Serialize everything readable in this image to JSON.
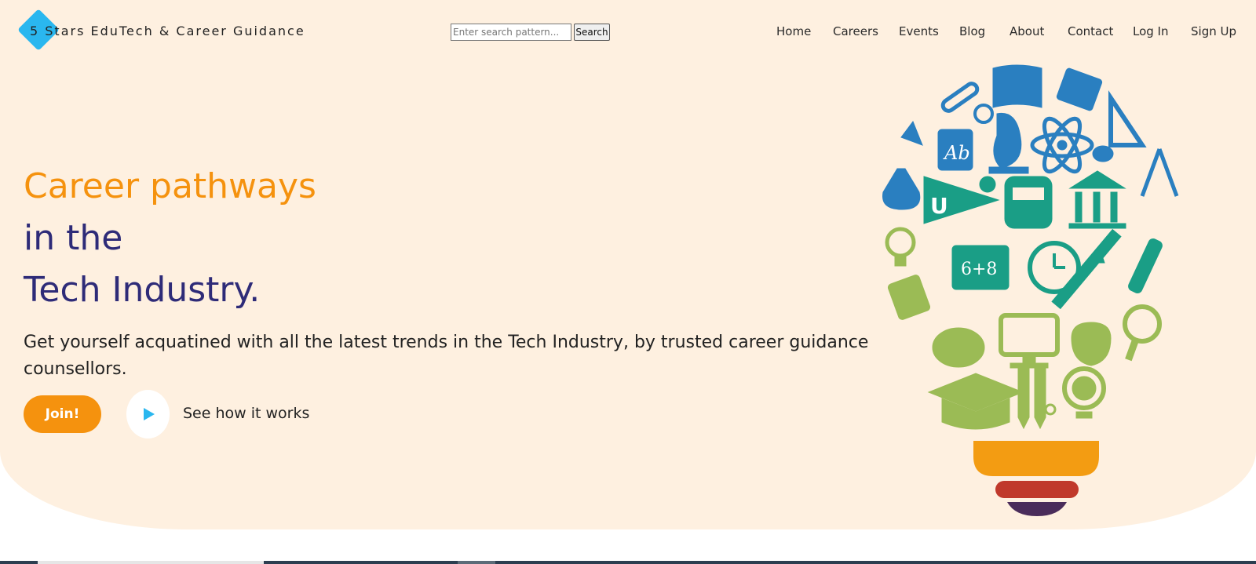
{
  "brand": {
    "name": "5 Stars EduTech & Career Guidance"
  },
  "search": {
    "placeholder": "Enter search pattern...",
    "button_label": "Search"
  },
  "nav": {
    "items": [
      "Home",
      "Careers",
      "Events",
      "Blog",
      "About",
      "Contact",
      "Log In",
      "Sign Up"
    ]
  },
  "hero": {
    "headline_line1": "Career pathways",
    "headline_line2": "in the",
    "headline_line3": "Tech Industry.",
    "subtext": "Get yourself acquatined with all the latest trends in the Tech Industry, by trusted career guidance counsellors.",
    "join_label": "Join!",
    "see_how_label": "See how it works"
  },
  "illustration": {
    "icon": "education-lightbulb-icon"
  },
  "colors": {
    "hero_bg": "#fef0e0",
    "orange": "#f5920e",
    "navy": "#2e2b78",
    "blue": "#2a7fc0",
    "teal": "#1a9e86",
    "green": "#9bbb55",
    "sky": "#2ab7ef"
  }
}
